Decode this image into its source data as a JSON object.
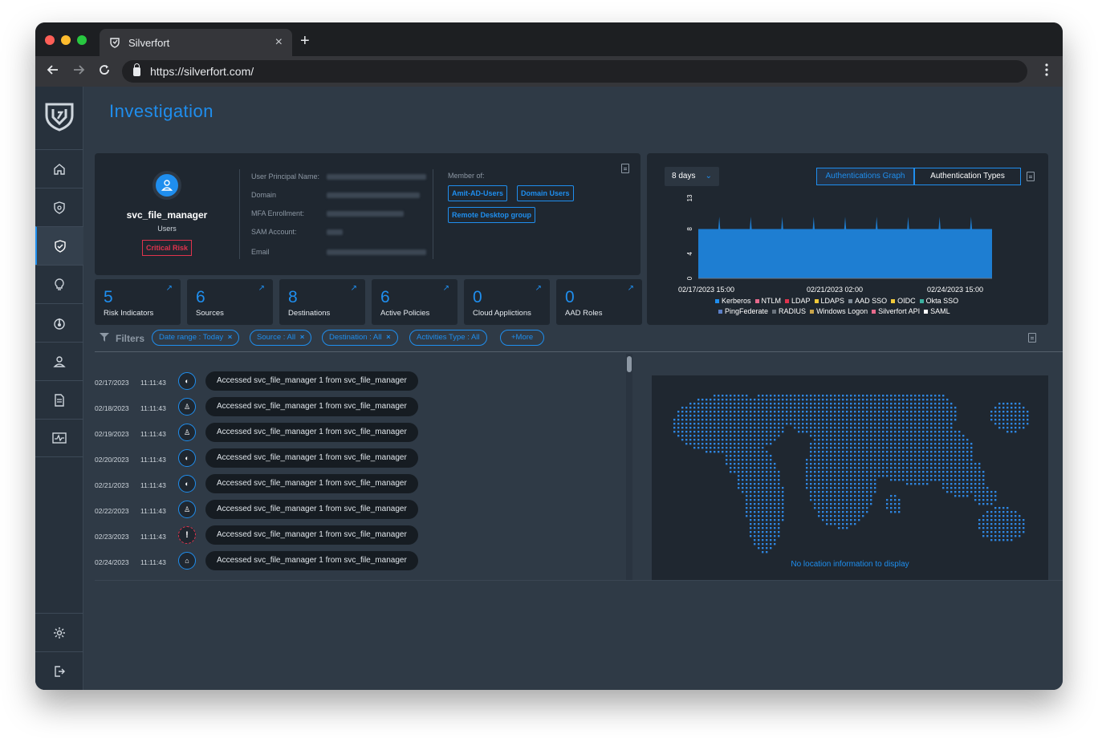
{
  "browser": {
    "tab_title": "Silverfort",
    "tab_close": "×",
    "new_tab": "+",
    "url": "https://silverfort.com/"
  },
  "page": {
    "title": "Investigation"
  },
  "user": {
    "name": "svc_file_manager",
    "type": "Users",
    "risk": "Critical Risk",
    "fields": [
      {
        "label": "User Principal Name:"
      },
      {
        "label": "Domain"
      },
      {
        "label": "MFA Enrollment:"
      },
      {
        "label": "SAM Account:"
      },
      {
        "label": "Email"
      }
    ],
    "member_label": "Member of:",
    "groups": [
      "Amit-AD-Users",
      "Domain Users",
      "Remote Desktop group"
    ]
  },
  "stats": [
    {
      "value": "5",
      "label": "Risk Indicators"
    },
    {
      "value": "6",
      "label": "Sources"
    },
    {
      "value": "8",
      "label": "Destinations"
    },
    {
      "value": "6",
      "label": "Active Policies"
    },
    {
      "value": "0",
      "label": "Cloud Applictions"
    },
    {
      "value": "0",
      "label": "AAD Roles"
    }
  ],
  "graph": {
    "range_select": "8 days",
    "toggle_graph": "Authentications Graph",
    "toggle_types": "Authentication Types"
  },
  "chart_data": {
    "type": "area",
    "x_ticks": [
      "02/17/2023 15:00",
      "02/21/2023 02:00",
      "02/24/2023 15:00"
    ],
    "y_ticks": [
      "0",
      "4",
      "8",
      "13"
    ],
    "ylim": [
      0,
      13
    ],
    "series": [
      {
        "name": "Kerberos",
        "values": [
          8,
          8,
          10,
          8,
          8,
          10,
          8,
          8,
          10,
          8,
          8,
          10,
          8,
          8,
          10,
          8,
          8,
          10,
          8,
          8,
          10,
          8,
          8,
          10,
          8,
          8,
          10,
          8,
          8
        ]
      }
    ],
    "legend": [
      {
        "name": "Kerberos",
        "color": "#1f8eee"
      },
      {
        "name": "NTLM",
        "color": "#e86a8c"
      },
      {
        "name": "LDAP",
        "color": "#e0334d"
      },
      {
        "name": "LDAPS",
        "color": "#f0c93a"
      },
      {
        "name": "AAD SSO",
        "color": "#7f8c98"
      },
      {
        "name": "OIDC",
        "color": "#f0c93a"
      },
      {
        "name": "Okta SSO",
        "color": "#3bb0a0"
      },
      {
        "name": "PingFederate",
        "color": "#5b7fc7"
      },
      {
        "name": "RADIUS",
        "color": "#6a737d"
      },
      {
        "name": "Windows Logon",
        "color": "#c9a44a"
      },
      {
        "name": "Silverfort API",
        "color": "#e86a8c"
      },
      {
        "name": "SAML",
        "color": "#ffffff"
      }
    ]
  },
  "filters": {
    "label": "Filters",
    "chips": [
      "Date range : Today",
      "Source : All",
      "Destination : All",
      "Activities Type : All"
    ],
    "more": "+More",
    "remove": "×"
  },
  "events": [
    {
      "date": "02/17/2023",
      "time": "11:11:43",
      "icon": "network-icon",
      "text": "Accessed svc_file_manager 1 from svc_file_manager"
    },
    {
      "date": "02/18/2023",
      "time": "11:11:43",
      "icon": "user-icon",
      "text": "Accessed svc_file_manager 1 from svc_file_manager"
    },
    {
      "date": "02/19/2023",
      "time": "11:11:43",
      "icon": "user-icon",
      "text": "Accessed svc_file_manager 1 from svc_file_manager"
    },
    {
      "date": "02/20/2023",
      "time": "11:11:43",
      "icon": "network-icon",
      "text": "Accessed svc_file_manager 1 from svc_file_manager"
    },
    {
      "date": "02/21/2023",
      "time": "11:11:43",
      "icon": "network-icon",
      "text": "Accessed svc_file_manager 1 from svc_file_manager"
    },
    {
      "date": "02/22/2023",
      "time": "11:11:43",
      "icon": "user-icon",
      "text": "Accessed svc_file_manager 1 from svc_file_manager"
    },
    {
      "date": "02/23/2023",
      "time": "11:11:43",
      "icon": "warning-icon",
      "text": "Accessed svc_file_manager 1 from svc_file_manager"
    },
    {
      "date": "02/24/2023",
      "time": "11:11:43",
      "icon": "user-device-icon",
      "text": "Accessed svc_file_manager 1 from svc_file_manager"
    }
  ],
  "map": {
    "message": "No location information to display"
  }
}
